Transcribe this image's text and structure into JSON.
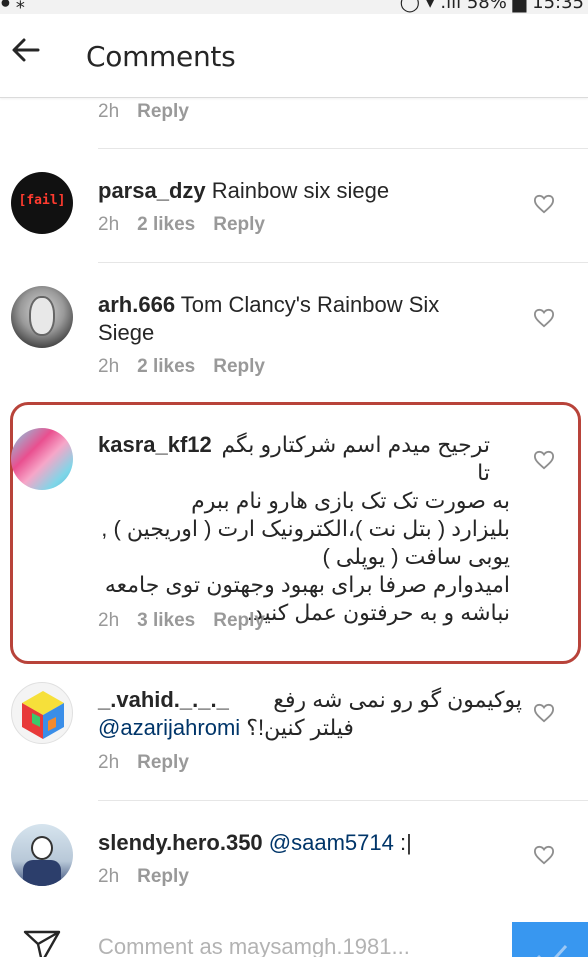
{
  "status_bar": {
    "left": "● ⁎",
    "right": "◯ ▾ .ıll 58% ▆ 15:35"
  },
  "header": {
    "title": "Comments"
  },
  "top_meta": {
    "time": "2h",
    "reply": "Reply"
  },
  "comments": [
    {
      "username": "parsa_dzy",
      "text": " Rainbow six siege",
      "time": "2h",
      "likes": "2 likes",
      "reply": "Reply",
      "avatar_label": "[fail]"
    },
    {
      "username": "arh.666",
      "text": " Tom Clancy's Rainbow Six Siege",
      "time": "2h",
      "likes": "2 likes",
      "reply": "Reply"
    },
    {
      "username": "kasra_kf12",
      "line1": "ترجیح میدم اسم شرکتارو بگم تا",
      "line2": "به صورت تک تک بازی هارو نام ببرم",
      "line3": "بلیزارد ( بتل نت )،الکترونیک ارت ( اوریجین ) ,",
      "line4": "یوبی سافت ( یوپلی )",
      "line5": "امیدوارم صرفا برای بهبود وجهتون توی جامعه",
      "line6": "نباشه و به حرفتون عمل کنید.",
      "time": "2h",
      "likes": "3 likes",
      "reply": "Reply"
    },
    {
      "username": "_.vahid._._._",
      "text_fa": "پوکیمون گو رو نمی شه رفع",
      "mention": "@azarijahromi",
      "text_fa2": " فیلتر کنین!؟",
      "time": "2h",
      "reply": "Reply"
    },
    {
      "username": "slendy.hero.350",
      "mention": " @saam5714",
      "text": " :|",
      "time": "2h",
      "reply": "Reply"
    }
  ],
  "composer": {
    "placeholder": "Comment as maysamgh.1981..."
  },
  "colors": {
    "highlight": "#b8433a",
    "post_button": "#3897f0",
    "mention": "#003569",
    "meta": "#999999"
  }
}
